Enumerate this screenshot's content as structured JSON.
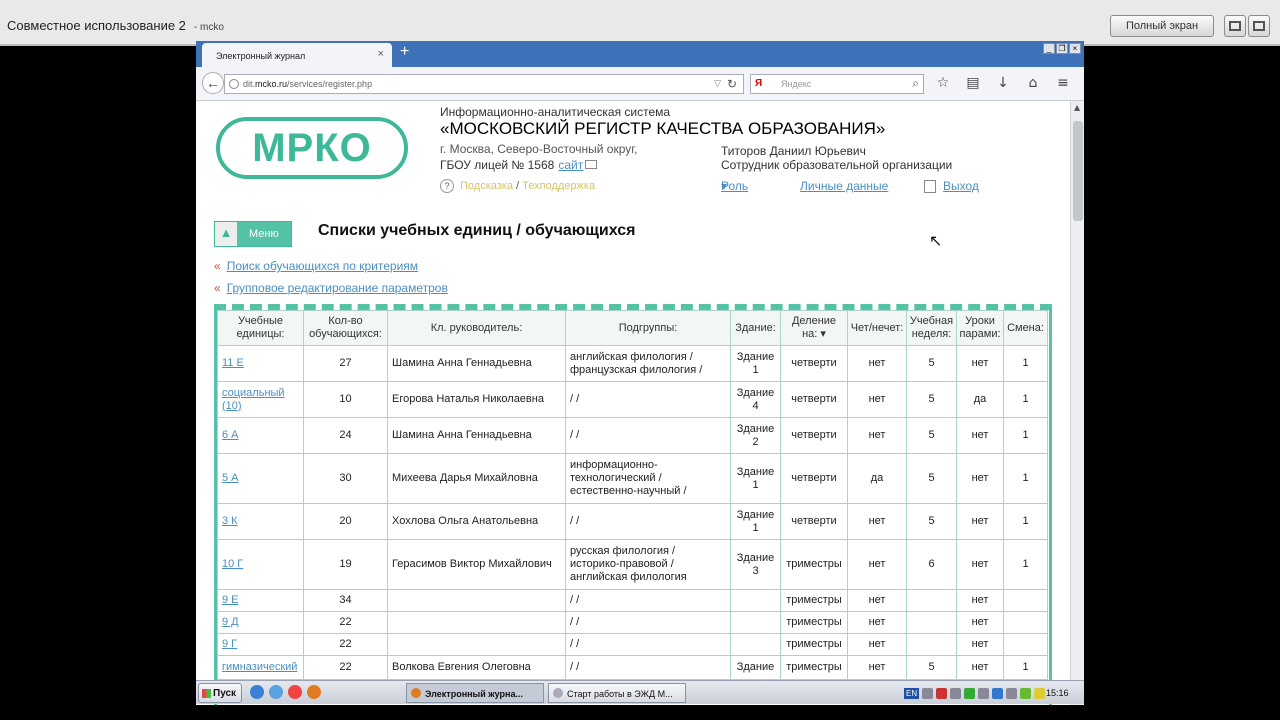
{
  "session": {
    "title": "Совместное использование 2",
    "sub": "- mcko",
    "fullscreen_label": "Полный экран"
  },
  "browser": {
    "tab_title": "Электронный журнал",
    "tab_close": "×",
    "new_tab": "+",
    "url_prefix": "dit.",
    "url_domain": "mcko.ru",
    "url_path": "/services/register.php",
    "search_placeholder": "Яндекс",
    "search_brand": "Я"
  },
  "header": {
    "logo_text": "МРКО",
    "system_line": "Информационно-аналитическая система",
    "system_name": "«МОСКОВСКИЙ РЕГИСТР КАЧЕСТВА ОБРАЗОВАНИЯ»",
    "org_region": "г. Москва, Северо-Восточный округ,",
    "org_name": "ГБОУ лицей № 1568",
    "org_site": "сайт",
    "help_link": "Подсказка",
    "help_sep": "/",
    "support_link": "Техподдержка",
    "user_name": "Титоров Даниил Юрьевич",
    "user_role": "Сотрудник образовательной организации",
    "role_menu": "Роль",
    "personal_data": "Личные данные",
    "logout": "Выход"
  },
  "page": {
    "menu_label": "Меню",
    "title": "Списки учебных единиц / обучающихся",
    "link_search": "Поиск обучающихся по критериям",
    "link_group_edit": "Групповое редактирование параметров",
    "link_marker": "«"
  },
  "table": {
    "headers": [
      "Учебные единицы:",
      "Кол-во обучающихся:",
      "Кл. руководитель:",
      "Подгруппы:",
      "Здание:",
      "Деление на: ▾",
      "Чет/нечет:",
      "Учебная неделя:",
      "Уроки парами:",
      "Смена:"
    ],
    "rows": [
      {
        "unit": "11 Е",
        "count": "27",
        "teacher": "Шамина Анна Геннадьевна",
        "subgroups": "английская филология / французская филология /",
        "building": "Здание 1",
        "division": "четверти",
        "evenodd": "нет",
        "week": "5",
        "pairs": "нет",
        "shift": "1"
      },
      {
        "unit": "социальный (10)",
        "count": "10",
        "teacher": "Егорова Наталья Николаевна",
        "subgroups": "/ /",
        "building": "Здание 4",
        "division": "четверти",
        "evenodd": "нет",
        "week": "5",
        "pairs": "да",
        "shift": "1"
      },
      {
        "unit": "6 А",
        "count": "24",
        "teacher": "Шамина Анна Геннадьевна",
        "subgroups": "/ /",
        "building": "Здание 2",
        "division": "четверти",
        "evenodd": "нет",
        "week": "5",
        "pairs": "нет",
        "shift": "1"
      },
      {
        "unit": "5 А",
        "count": "30",
        "teacher": "Михеева Дарья Михайловна",
        "subgroups": "информационно-технологический / естественно-научный /",
        "building": "Здание 1",
        "division": "четверти",
        "evenodd": "да",
        "week": "5",
        "pairs": "нет",
        "shift": "1"
      },
      {
        "unit": "3 К",
        "count": "20",
        "teacher": "Хохлова Ольга Анатольевна",
        "subgroups": "/ /",
        "building": "Здание 1",
        "division": "четверти",
        "evenodd": "нет",
        "week": "5",
        "pairs": "нет",
        "shift": "1"
      },
      {
        "unit": "10 Г",
        "count": "19",
        "teacher": "Герасимов Виктор Михайлович",
        "subgroups": "русская филология / историко-правовой / английская филология",
        "building": "Здание 3",
        "division": "триместры",
        "evenodd": "нет",
        "week": "6",
        "pairs": "нет",
        "shift": "1"
      },
      {
        "unit": "9 Е",
        "count": "34",
        "teacher": "",
        "subgroups": "/ /",
        "building": "",
        "division": "триместры",
        "evenodd": "нет",
        "week": "",
        "pairs": "нет",
        "shift": ""
      },
      {
        "unit": "9 Д",
        "count": "22",
        "teacher": "",
        "subgroups": "/ /",
        "building": "",
        "division": "триместры",
        "evenodd": "нет",
        "week": "",
        "pairs": "нет",
        "shift": ""
      },
      {
        "unit": "9 Г",
        "count": "22",
        "teacher": "",
        "subgroups": "/ /",
        "building": "",
        "division": "триместры",
        "evenodd": "нет",
        "week": "",
        "pairs": "нет",
        "shift": ""
      },
      {
        "unit": "гимназический",
        "count": "22",
        "teacher": "Волкова Евгения Олеговна",
        "subgroups": "/ /",
        "building": "Здание",
        "division": "триместры",
        "evenodd": "нет",
        "week": "5",
        "pairs": "нет",
        "shift": "1"
      }
    ]
  },
  "taskbar": {
    "start": "Пуск",
    "task1": "Электронный журна...",
    "task2": "Старт работы в ЭЖД М...",
    "lang": "EN",
    "clock": "15:16"
  },
  "colors": {
    "accent": "#53c2a6",
    "link": "#4a8fc0",
    "tab_strip": "#3d72b8"
  }
}
